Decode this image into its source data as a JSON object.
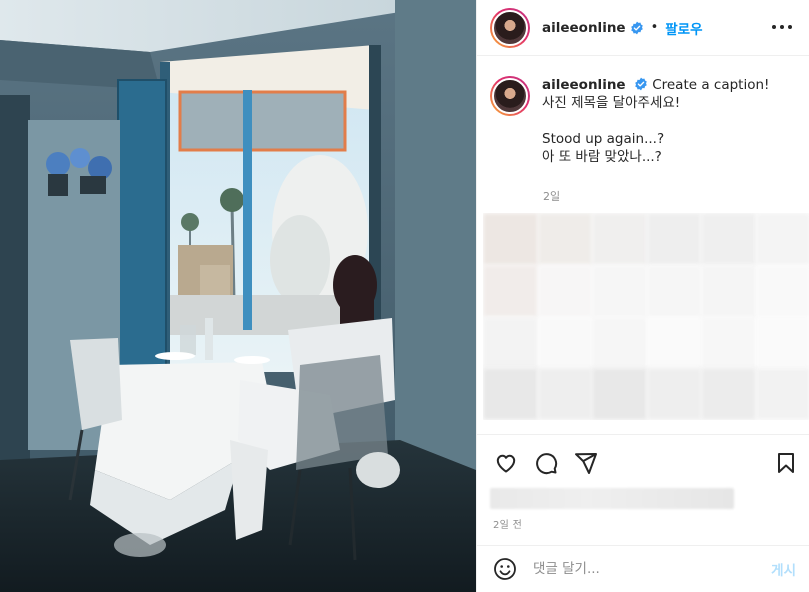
{
  "post": {
    "username": "aileeonline",
    "follow_label": "팔로우",
    "separator": "•",
    "caption": {
      "username": "aileeonline",
      "line1": "Create a caption!",
      "line2": "사진 제목을 달아주세요!",
      "line3": "Stood up again...?",
      "line4": "아 또 바람 맞았나...?",
      "age": "2일"
    },
    "post_age": "2일 전"
  },
  "comment_bar": {
    "placeholder": "댓글 달기...",
    "post_label": "게시"
  },
  "icons": {
    "more": "more-options-icon",
    "verified": "verified-badge-icon",
    "like": "heart-icon",
    "comment": "comment-icon",
    "share": "paper-plane-icon",
    "save": "bookmark-icon",
    "emoji": "emoji-icon"
  },
  "colors": {
    "follow": "#0095f6",
    "verified": "#3897f0",
    "post_disabled": "#b2dffc"
  }
}
